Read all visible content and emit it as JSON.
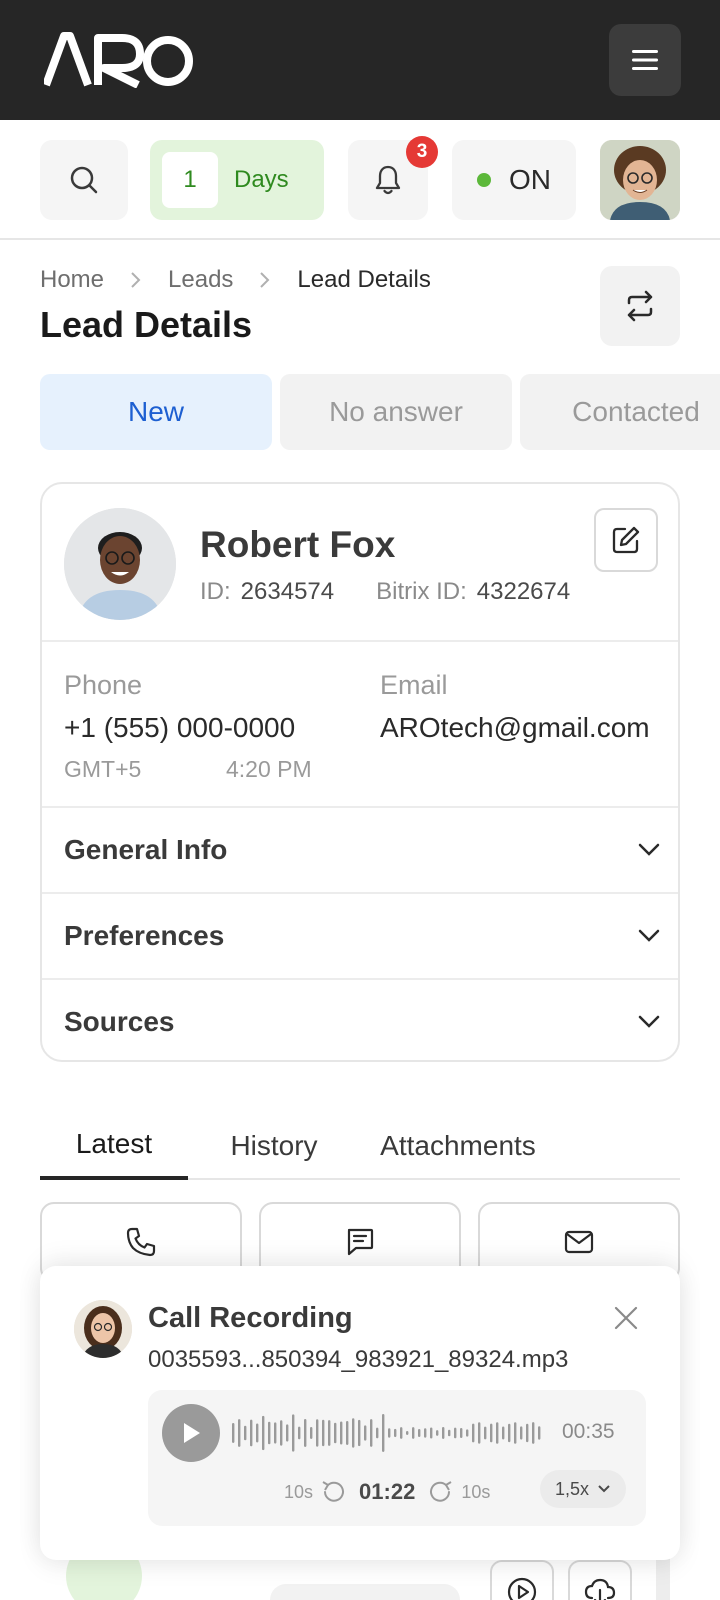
{
  "header": {
    "logo_text": "ARO",
    "menu_icon": "hamburger-icon"
  },
  "toolbar": {
    "search_icon": "search-icon",
    "days_count": "1",
    "days_label": "Days",
    "notification_count": "3",
    "status_label": "ON",
    "status_color": "#5cb83a"
  },
  "breadcrumb": {
    "items": [
      "Home",
      "Leads",
      "Lead Details"
    ]
  },
  "page": {
    "title": "Lead Details"
  },
  "status_tabs": [
    "New",
    "No answer",
    "Contacted"
  ],
  "lead": {
    "name": "Robert Fox",
    "id_label": "ID:",
    "id_value": "2634574",
    "bitrix_label": "Bitrix ID:",
    "bitrix_value": "4322674",
    "phone_label": "Phone",
    "phone_value": "+1 (555) 000-0000",
    "timezone": "GMT+5",
    "local_time": "4:20 PM",
    "email_label": "Email",
    "email_value": "AROtech@gmail.com",
    "sections": [
      "General Info",
      "Preferences",
      "Sources"
    ]
  },
  "content_tabs": [
    "Latest",
    "History",
    "Attachments"
  ],
  "actions": [
    "phone-icon",
    "message-icon",
    "mail-icon"
  ],
  "recording": {
    "title": "Call Recording",
    "filename": "0035593...850394_983921_89324.mp3",
    "duration": "00:35",
    "current_time": "01:22",
    "skip_back": "10s",
    "skip_forward": "10s",
    "speed": "1,5x"
  },
  "colors": {
    "accent_blue": "#1d5fd1",
    "accent_green": "#2f8a1f",
    "badge_red": "#e53935",
    "dark": "#262626"
  }
}
